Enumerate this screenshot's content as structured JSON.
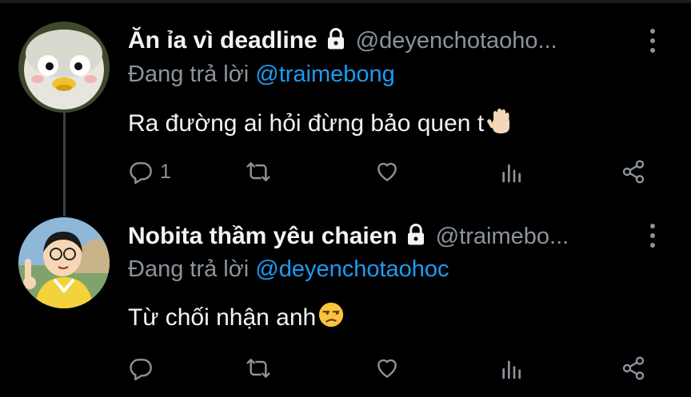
{
  "colors": {
    "background": "#000000",
    "text": "#f3f3f3",
    "muted": "#8b949d",
    "mention": "#1d9bf0"
  },
  "tweets": [
    {
      "display_name": "Ăn ỉa vì deadline",
      "handle": "@deyenchotaoho...",
      "replying_prefix": "Đang trả lời",
      "replying_to": "@traimebong",
      "text": "Ra đường ai hỏi đừng bảo quen t",
      "emoji_icon": "raised-hand-emoji",
      "reply_count": "1"
    },
    {
      "display_name": "Nobita thầm yêu chaien",
      "handle": "@traimebo...",
      "replying_prefix": "Đang trả lời",
      "replying_to": "@deyenchotaohoc",
      "text": "Từ chối nhận anh",
      "emoji_icon": "unamused-face-emoji",
      "reply_count": ""
    }
  ]
}
